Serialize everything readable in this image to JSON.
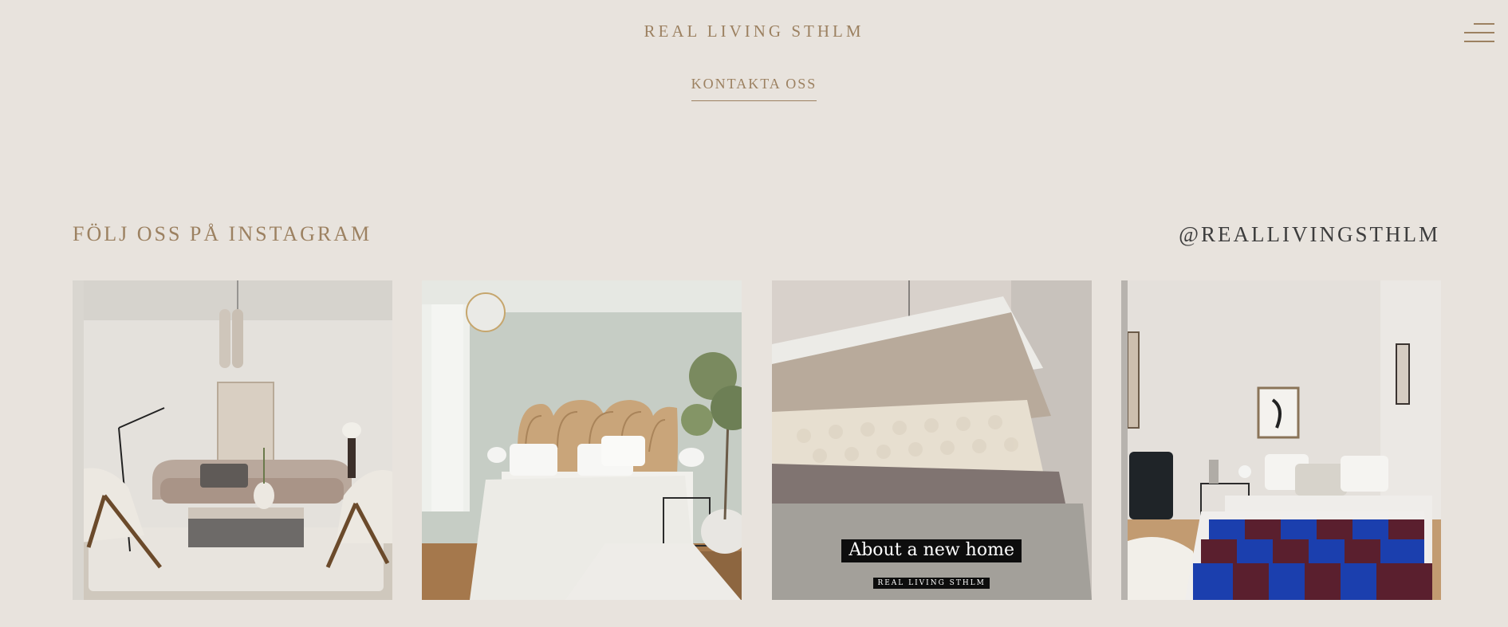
{
  "header": {
    "brand": "REAL LIVING STHLM",
    "menu_icon": "hamburger-menu-icon",
    "contact_label": "KONTAKTA OSS"
  },
  "instagram": {
    "title": "FÖLJ OSS PÅ INSTAGRAM",
    "handle": "@REALLIVINGSTHLM",
    "posts": [
      {
        "overlay_title": "",
        "overlay_sub": ""
      },
      {
        "overlay_title": "",
        "overlay_sub": ""
      },
      {
        "overlay_title": "About a new home",
        "overlay_sub": "REAL LIVING STHLM"
      },
      {
        "overlay_title": "",
        "overlay_sub": ""
      }
    ]
  },
  "colors": {
    "background": "#e8e3dd",
    "accent": "#9c8161",
    "handle": "#3d3d3d"
  }
}
